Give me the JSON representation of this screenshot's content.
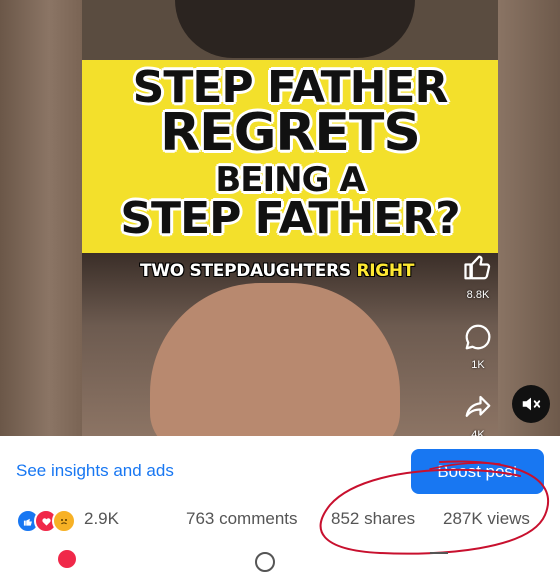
{
  "video": {
    "title_lines": [
      "STEP FATHER",
      "REGRETS",
      "BEING A",
      "STEP FATHER?"
    ],
    "subtitle_main": "TWO STEPDAUGHTERS ",
    "subtitle_highlight": "RIGHT",
    "likes_count": "8.8K",
    "comments_count": "1K",
    "shares_count": "4K"
  },
  "actions": {
    "insights_label": "See insights and ads",
    "boost_label": "Boost post"
  },
  "stats": {
    "reaction_count": "2.9K",
    "comments": "763 comments",
    "shares": "852 shares",
    "views": "287K views"
  },
  "colors": {
    "accent": "#1877f2",
    "annotation": "#c8102e",
    "video_yellow": "#f3e02b"
  }
}
